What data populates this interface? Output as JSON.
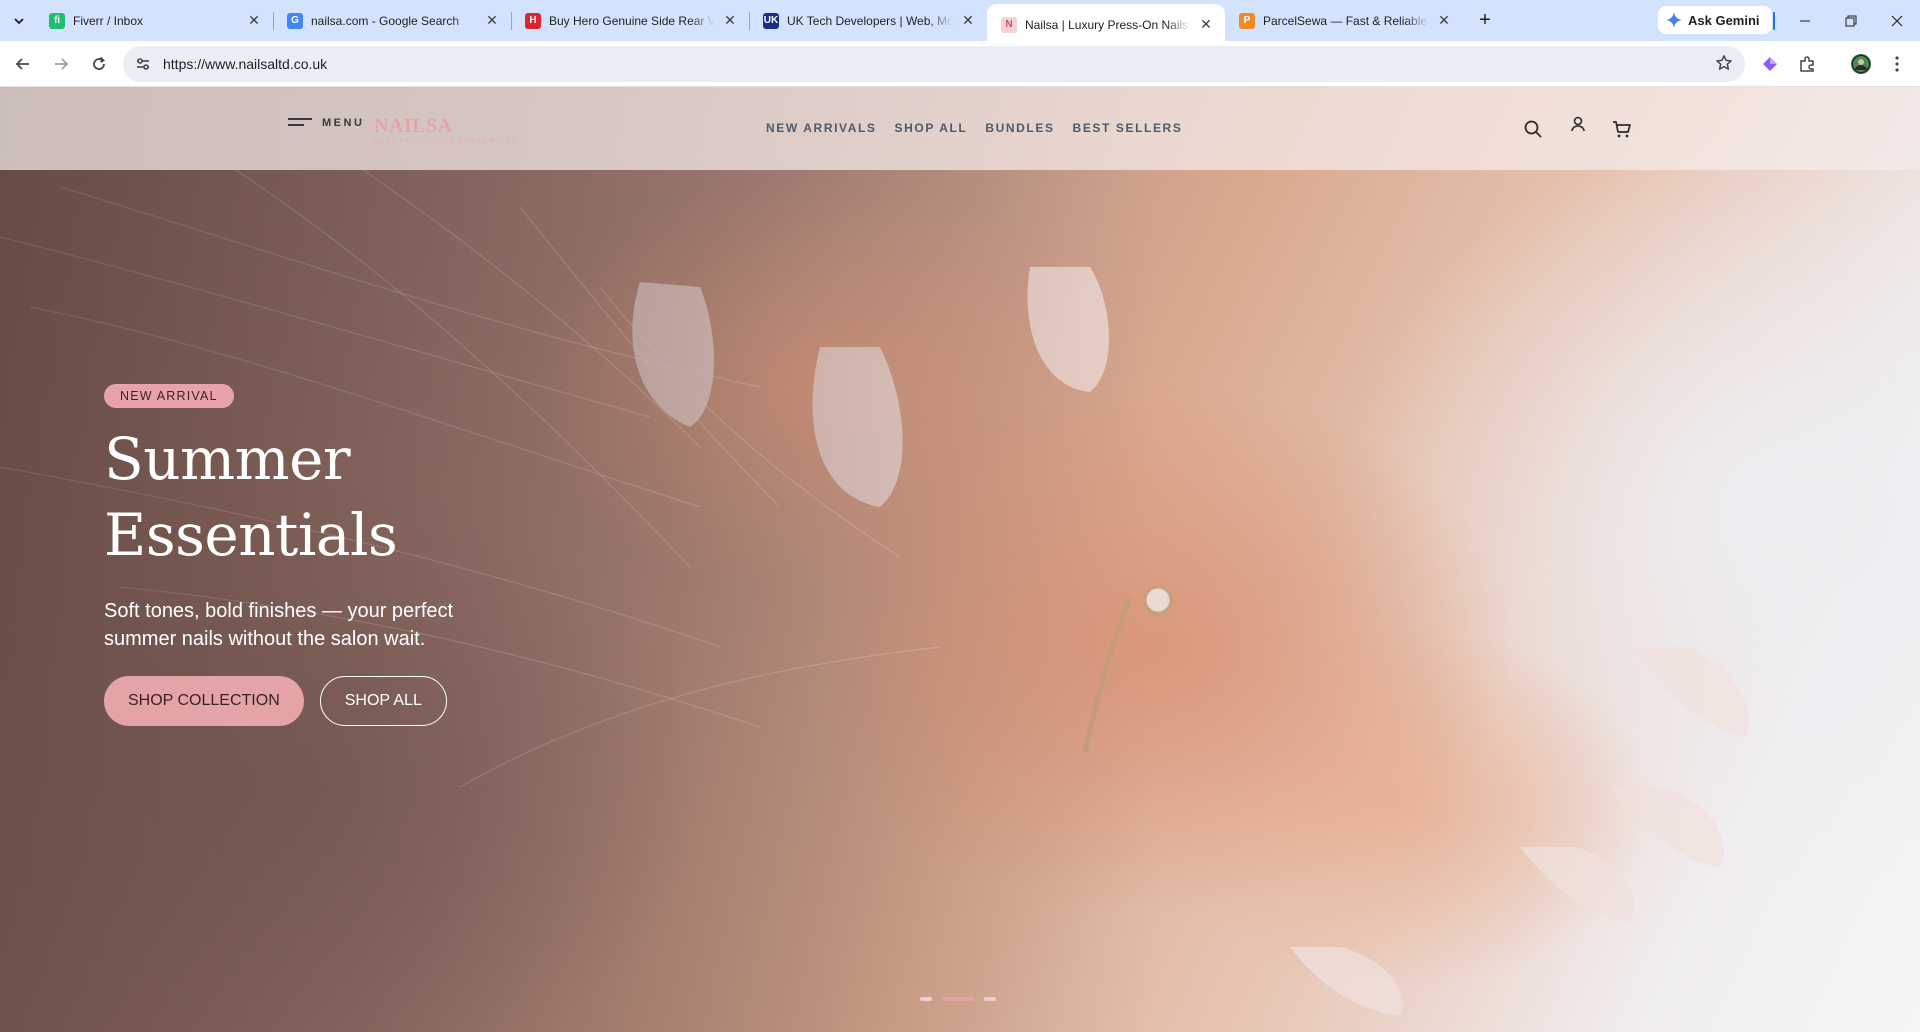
{
  "browser": {
    "tabs": [
      {
        "title": "Fiverr / Inbox",
        "favicon_color": "#1dbf73",
        "favicon_letter": "fi",
        "active": false
      },
      {
        "title": "nailsa.com - Google Search",
        "favicon_color": "#4285f4",
        "favicon_letter": "G",
        "active": false
      },
      {
        "title": "Buy Hero Genuine Side Rear Vie",
        "favicon_color": "#d9252f",
        "favicon_letter": "H",
        "active": false
      },
      {
        "title": "UK Tech Developers | Web, Mob",
        "favicon_color": "#1b2f8a",
        "favicon_letter": "UK",
        "active": false
      },
      {
        "title": "Nailsa | Luxury Press-On Nails fo",
        "favicon_color": "#f5d0d4",
        "favicon_letter": "N",
        "active": true
      },
      {
        "title": "ParcelSewa — Fast & Reliable Pa",
        "favicon_color": "#f08a24",
        "favicon_letter": "P",
        "active": false
      }
    ],
    "gemini_label": "Ask Gemini",
    "url": "https://www.nailsaltd.co.uk",
    "accent_color": "#d3e3fd"
  },
  "site": {
    "menu_label": "MENU",
    "logo_text": "NAILSA",
    "logo_tagline": "BEAUTY AT YOUR FINGERTIPS",
    "nav": [
      "NEW ARRIVALS",
      "SHOP ALL",
      "BUNDLES",
      "BEST SELLERS"
    ],
    "brand_color": "#e8a3a8",
    "icons": [
      "search-icon",
      "account-icon",
      "cart-icon"
    ]
  },
  "hero": {
    "badge": "NEW ARRIVAL",
    "title_line1": "Summer",
    "title_line2": "Essentials",
    "subtitle": "Soft tones, bold finishes — your perfect summer nails without the salon wait.",
    "cta_primary": "SHOP COLLECTION",
    "cta_secondary": "SHOP ALL",
    "slide_count": 3,
    "active_slide": 2
  }
}
